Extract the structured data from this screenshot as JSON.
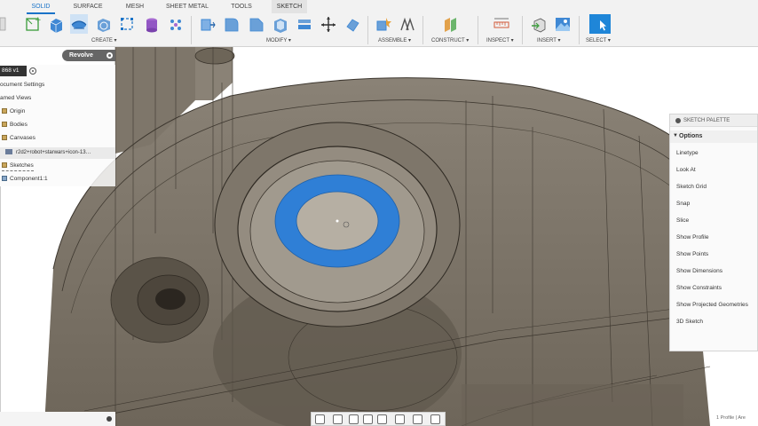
{
  "tabs": [
    "SOLID",
    "SURFACE",
    "MESH",
    "SHEET METAL",
    "TOOLS",
    "SKETCH"
  ],
  "toolbar_groups": {
    "create": "CREATE ▾",
    "modify": "MODIFY ▾",
    "assemble": "ASSEMBLE ▾",
    "construct": "CONSTRUCT ▾",
    "inspect": "INSPECT ▾",
    "insert": "INSERT ▾",
    "select": "SELECT ▾"
  },
  "command": {
    "label": "Revolve"
  },
  "browser": {
    "doc_title": "868 v1",
    "items": {
      "document_settings": "ocument Settings",
      "named_views": "amed Views",
      "origin": "Origin",
      "bodies": "Bodies",
      "canvases": "Canvases",
      "canvas_item": "r2d2+robot+starwars+icon-13…",
      "sketches": "Sketches",
      "component": "Component1:1"
    }
  },
  "palette": {
    "title": "SKETCH PALETTE",
    "options_header": "Options",
    "options": [
      "Linetype",
      "Look At",
      "Sketch Grid",
      "Snap",
      "Slice",
      "Show Profile",
      "Show Points",
      "Show Dimensions",
      "Show Constraints",
      "Show Projected Geometries",
      "3D Sketch"
    ]
  },
  "status": {
    "profile_note": "1 Profile | Are"
  },
  "colors": {
    "accent": "#1a73c8",
    "profile_ring": "#2f7fd6",
    "body": "#6f675c"
  }
}
